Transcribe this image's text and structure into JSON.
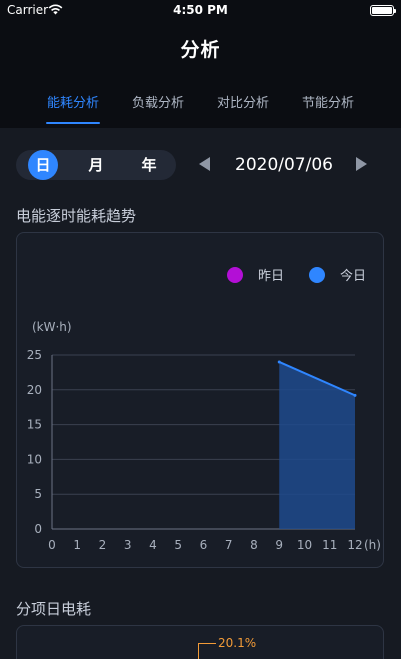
{
  "status": {
    "carrier": "Carrier",
    "time": "4:50 PM"
  },
  "header": {
    "title": "分析"
  },
  "tabs": [
    {
      "label": "能耗分析",
      "active": true
    },
    {
      "label": "负载分析",
      "active": false
    },
    {
      "label": "对比分析",
      "active": false
    },
    {
      "label": "节能分析",
      "active": false
    }
  ],
  "period": {
    "options": [
      "日",
      "月",
      "年"
    ],
    "selected": "日",
    "date": "2020/07/06"
  },
  "trend_section": {
    "title": "电能逐时能耗趋势"
  },
  "sub_section": {
    "title": "分项日电耗",
    "top_slice_label": "20.1%"
  },
  "colors": {
    "accent": "#2f86ff",
    "yesterday": "#b30fd6",
    "today": "#2f86ff",
    "highlight": "#f29b38"
  },
  "chart_data": {
    "type": "area",
    "unit_label": "(kW·h)",
    "x_unit_label": "(h)",
    "x": [
      0,
      1,
      2,
      3,
      4,
      5,
      6,
      7,
      8,
      9,
      10,
      11,
      12
    ],
    "x_tick_labels": [
      "0",
      "1",
      "2",
      "3",
      "4",
      "5",
      "6",
      "7",
      "8",
      "9",
      "10",
      "11",
      "12"
    ],
    "ylim": [
      0,
      25
    ],
    "y_ticks": [
      0,
      5,
      10,
      15,
      20,
      25
    ],
    "grid": true,
    "legend_position": "top-right",
    "series": [
      {
        "name": "昨日",
        "color": "#b30fd6",
        "points": []
      },
      {
        "name": "今日",
        "color": "#2f86ff",
        "points": [
          [
            9,
            24
          ],
          [
            12,
            19.2
          ]
        ]
      }
    ]
  }
}
